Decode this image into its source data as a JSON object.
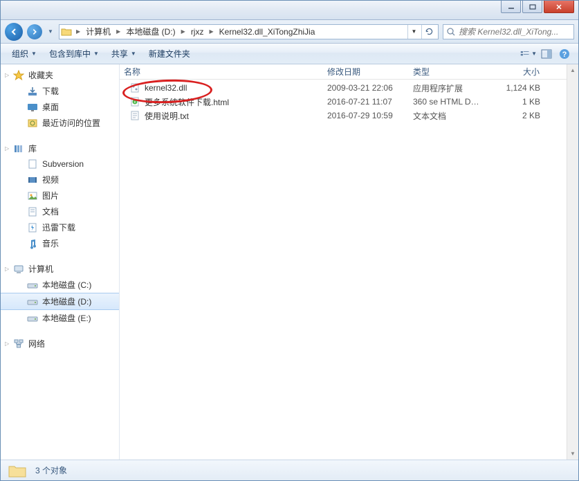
{
  "titlebar": {
    "title": ""
  },
  "address": {
    "segments": [
      "计算机",
      "本地磁盘 (D:)",
      "rjxz",
      "Kernel32.dll_XiTongZhiJia"
    ]
  },
  "search": {
    "placeholder": "搜索 Kernel32.dll_XiTong..."
  },
  "toolbar": {
    "organize": "组织",
    "include": "包含到库中",
    "share": "共享",
    "newfolder": "新建文件夹"
  },
  "nav": {
    "favorites": {
      "label": "收藏夹",
      "items": [
        "下载",
        "桌面",
        "最近访问的位置"
      ]
    },
    "libraries": {
      "label": "库",
      "items": [
        "Subversion",
        "视频",
        "图片",
        "文档",
        "迅雷下载",
        "音乐"
      ]
    },
    "computer": {
      "label": "计算机",
      "items": [
        "本地磁盘 (C:)",
        "本地磁盘 (D:)",
        "本地磁盘 (E:)"
      ]
    },
    "network": {
      "label": "网络"
    }
  },
  "columns": {
    "name": "名称",
    "date": "修改日期",
    "type": "类型",
    "size": "大小"
  },
  "files": [
    {
      "name": "kernel32.dll",
      "date": "2009-03-21 22:06",
      "type": "应用程序扩展",
      "size": "1,124 KB",
      "icon": "dll"
    },
    {
      "name": "更多系统软件下载.html",
      "date": "2016-07-21 11:07",
      "type": "360 se HTML Do...",
      "size": "1 KB",
      "icon": "html"
    },
    {
      "name": "使用说明.txt",
      "date": "2016-07-29 10:59",
      "type": "文本文档",
      "size": "2 KB",
      "icon": "txt"
    }
  ],
  "status": {
    "count": "3 个对象"
  }
}
